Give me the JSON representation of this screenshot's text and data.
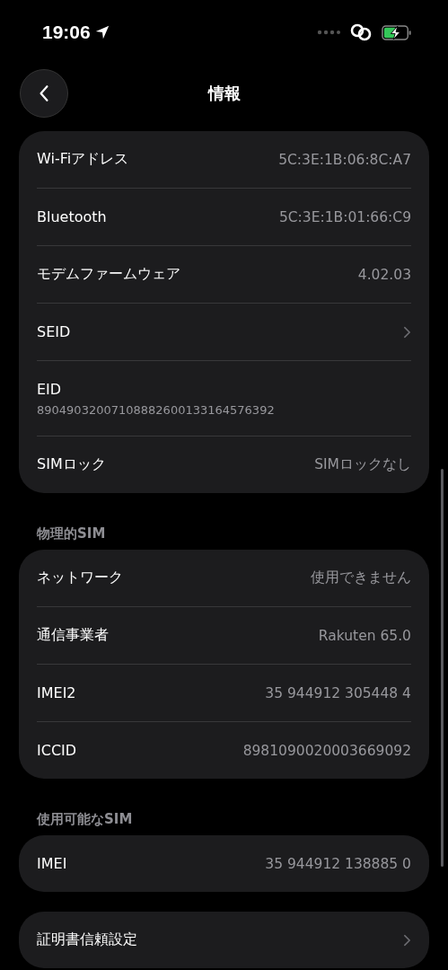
{
  "status_bar": {
    "time": "19:06"
  },
  "nav": {
    "title": "情報"
  },
  "sections": [
    {
      "rows": [
        {
          "kind": "value",
          "label": "Wi-Fiアドレス",
          "value": "5C:3E:1B:06:8C:A7"
        },
        {
          "kind": "value",
          "label": "Bluetooth",
          "value": "5C:3E:1B:01:66:C9"
        },
        {
          "kind": "value",
          "label": "モデムファームウェア",
          "value": "4.02.03"
        },
        {
          "kind": "chevron",
          "label": "SEID"
        },
        {
          "kind": "stacked",
          "label": "EID",
          "value": "89049032007108882600133164576392"
        },
        {
          "kind": "value",
          "label": "SIMロック",
          "value": "SIMロックなし"
        }
      ]
    },
    {
      "header": "物理的SIM",
      "rows": [
        {
          "kind": "value",
          "label": "ネットワーク",
          "value": "使用できません"
        },
        {
          "kind": "value",
          "label": "通信事業者",
          "value": "Rakuten 65.0"
        },
        {
          "kind": "value",
          "label": "IMEI2",
          "value": "35 944912 305448 4"
        },
        {
          "kind": "value",
          "label": "ICCID",
          "value": "8981090020003669092"
        }
      ]
    },
    {
      "header": "使用可能なSIM",
      "rows": [
        {
          "kind": "value",
          "label": "IMEI",
          "value": "35 944912 138885 0"
        }
      ]
    },
    {
      "rows": [
        {
          "kind": "chevron",
          "label": "証明書信頼設定"
        }
      ]
    }
  ]
}
